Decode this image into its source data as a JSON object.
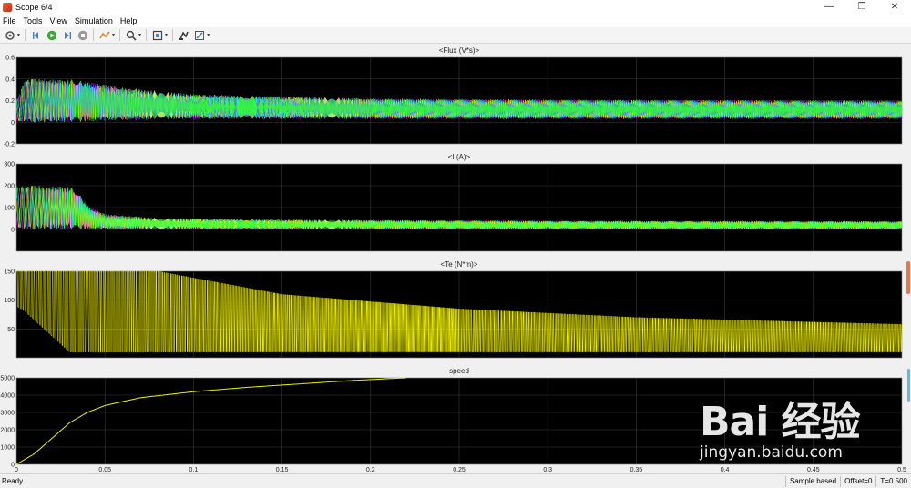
{
  "window": {
    "title": "Scope 6/4",
    "minimize": "—",
    "maximize": "❐",
    "close": "✕"
  },
  "menu": [
    "File",
    "Tools",
    "View",
    "Simulation",
    "Help"
  ],
  "toolbar": {
    "icons": [
      "settings-icon",
      "step-back-icon",
      "run-icon",
      "step-forward-icon",
      "stop-icon",
      "highlight-icon",
      "zoom-icon",
      "fit-icon",
      "pan-icon",
      "style-icon"
    ]
  },
  "status": {
    "ready": "Ready",
    "sample": "Sample based",
    "offset": "Offset=0",
    "time": "T=0.500"
  },
  "watermark": {
    "brand": "Bai 经验",
    "url": "jingyan.baidu.com"
  },
  "colors": {
    "axes_bg": "#000000",
    "grid": "#3a3a3a",
    "phase_a": "#ff00ff",
    "phase_b": "#00ffff",
    "phase_c": "#ffff00",
    "phase_d": "#3f6fff",
    "phase_e": "#33ff33",
    "te": "#ffff00",
    "speed": "#ffff00"
  },
  "x_ticks": [
    "0",
    "0.05",
    "0.1",
    "0.15",
    "0.2",
    "0.25",
    "0.3",
    "0.35",
    "0.4",
    "0.45",
    "0.5"
  ],
  "chart_data": [
    {
      "type": "line",
      "title": "<Flux (V*s)>",
      "xlim": [
        0,
        0.5
      ],
      "ylim": [
        -0.2,
        0.6
      ],
      "yticks": [
        "0.6",
        "0.4",
        "0.2",
        "0",
        "-0.2"
      ],
      "grid": true,
      "series": [
        {
          "color": "#ff00ff",
          "shape": "pulse",
          "phase": 0.0
        },
        {
          "color": "#00ffff",
          "shape": "pulse",
          "phase": 0.33
        },
        {
          "color": "#ffff00",
          "shape": "pulse",
          "phase": 0.66
        },
        {
          "color": "#3f6fff",
          "shape": "pulse",
          "phase": 0.16
        },
        {
          "color": "#33ff33",
          "shape": "pulse",
          "phase": 0.5
        }
      ],
      "envelope": {
        "x": [
          0,
          0.005,
          0.03,
          0.06,
          0.1,
          0.2,
          0.3,
          0.5
        ],
        "high": [
          0.2,
          0.4,
          0.4,
          0.32,
          0.26,
          0.22,
          0.21,
          0.2
        ],
        "low": [
          0,
          0,
          0,
          0.02,
          0.03,
          0.03,
          0.03,
          0.03
        ]
      }
    },
    {
      "type": "line",
      "title": "<I (A)>",
      "xlim": [
        0,
        0.5
      ],
      "ylim": [
        -100,
        300
      ],
      "yticks": [
        "300",
        "200",
        "100",
        "0"
      ],
      "grid": true,
      "series": [
        {
          "color": "#ff00ff",
          "shape": "pulse",
          "phase": 0.0
        },
        {
          "color": "#00ffff",
          "shape": "pulse",
          "phase": 0.33
        },
        {
          "color": "#ffff00",
          "shape": "pulse",
          "phase": 0.66
        },
        {
          "color": "#33ff33",
          "shape": "pulse",
          "phase": 0.5
        }
      ],
      "envelope": {
        "x": [
          0,
          0.03,
          0.035,
          0.04,
          0.05,
          0.08,
          0.15,
          0.3,
          0.5
        ],
        "high": [
          200,
          200,
          170,
          110,
          70,
          52,
          45,
          40,
          38
        ],
        "low": [
          0,
          0,
          0,
          0,
          0,
          0,
          0,
          0,
          0
        ]
      }
    },
    {
      "type": "line",
      "title": "<Te (N*m)>",
      "xlim": [
        0,
        0.5
      ],
      "ylim": [
        0,
        150
      ],
      "yticks": [
        "150",
        "100",
        "50"
      ],
      "grid": true,
      "series": [
        {
          "color": "#ffff00",
          "shape": "ripple",
          "phase": 0.0
        }
      ],
      "envelope": {
        "x": [
          0,
          0.005,
          0.03,
          0.08,
          0.15,
          0.25,
          0.35,
          0.5
        ],
        "high": [
          150,
          150,
          150,
          150,
          110,
          85,
          70,
          58
        ],
        "low": [
          90,
          80,
          10,
          10,
          10,
          10,
          10,
          10
        ]
      }
    },
    {
      "type": "line",
      "title": "speed",
      "xlim": [
        0,
        0.5
      ],
      "ylim": [
        0,
        5000
      ],
      "yticks": [
        "5000",
        "4000",
        "3000",
        "2000",
        "1000",
        "0"
      ],
      "grid": true,
      "series": [
        {
          "color": "#ffff00",
          "shape": "curve",
          "x": [
            0,
            0.01,
            0.02,
            0.03,
            0.04,
            0.05,
            0.07,
            0.1,
            0.13,
            0.16,
            0.19,
            0.22
          ],
          "y": [
            0,
            600,
            1500,
            2400,
            3000,
            3400,
            3850,
            4200,
            4450,
            4650,
            4850,
            5000
          ]
        }
      ]
    }
  ]
}
